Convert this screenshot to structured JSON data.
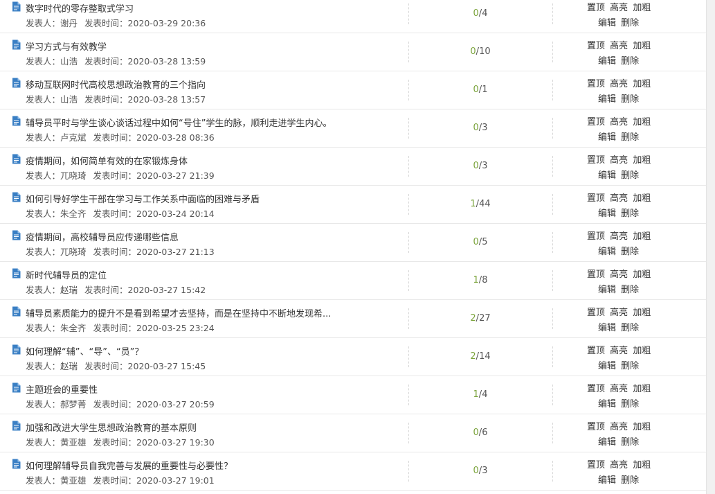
{
  "labels": {
    "author": "发表人：",
    "time": "发表时间：",
    "top": "置顶",
    "highlight": "高亮",
    "bold": "加粗",
    "edit": "编辑",
    "delete": "删除"
  },
  "colors": {
    "reply_count": "#7aa33a",
    "doc_icon": "#3a7fc4"
  },
  "posts": [
    {
      "title": "数字时代的零存整取式学习",
      "author": "谢丹",
      "time": "2020-03-29 20:36",
      "replies": "0",
      "views": "4"
    },
    {
      "title": "学习方式与有效教学",
      "author": "山浩",
      "time": "2020-03-28 13:59",
      "replies": "0",
      "views": "10"
    },
    {
      "title": "移动互联网时代高校思想政治教育的三个指向",
      "author": "山浩",
      "time": "2020-03-28 13:57",
      "replies": "0",
      "views": "1"
    },
    {
      "title": "辅导员平时与学生谈心谈话过程中如何“号住”学生的脉，顺利走进学生内心。",
      "author": "卢克斌",
      "time": "2020-03-28 08:36",
      "replies": "0",
      "views": "3"
    },
    {
      "title": "疫情期间，如何简单有效的在家锻炼身体",
      "author": "兀晓琦",
      "time": "2020-03-27 21:39",
      "replies": "0",
      "views": "3"
    },
    {
      "title": "如何引导好学生干部在学习与工作关系中面临的困难与矛盾",
      "author": "朱全齐",
      "time": "2020-03-24 20:14",
      "replies": "1",
      "views": "44"
    },
    {
      "title": "疫情期间，高校辅导员应传递哪些信息",
      "author": "兀晓琦",
      "time": "2020-03-27 21:13",
      "replies": "0",
      "views": "5"
    },
    {
      "title": "新时代辅导员的定位",
      "author": "赵瑞",
      "time": "2020-03-27 15:42",
      "replies": "1",
      "views": "8"
    },
    {
      "title": "辅导员素质能力的提升不是看到希望才去坚持，而是在坚持中不断地发现希...",
      "author": "朱全齐",
      "time": "2020-03-25 23:24",
      "replies": "2",
      "views": "27"
    },
    {
      "title": "如何理解“辅”、“导”、“员”？",
      "author": "赵瑞",
      "time": "2020-03-27 15:45",
      "replies": "2",
      "views": "14"
    },
    {
      "title": "主题班会的重要性",
      "author": "郝梦菁",
      "time": "2020-03-27 20:59",
      "replies": "1",
      "views": "4"
    },
    {
      "title": "加强和改进大学生思想政治教育的基本原则",
      "author": "黄亚雄",
      "time": "2020-03-27 19:30",
      "replies": "0",
      "views": "6"
    },
    {
      "title": "如何理解辅导员自我完善与发展的重要性与必要性？",
      "author": "黄亚雄",
      "time": "2020-03-27 19:01",
      "replies": "0",
      "views": "3"
    }
  ]
}
